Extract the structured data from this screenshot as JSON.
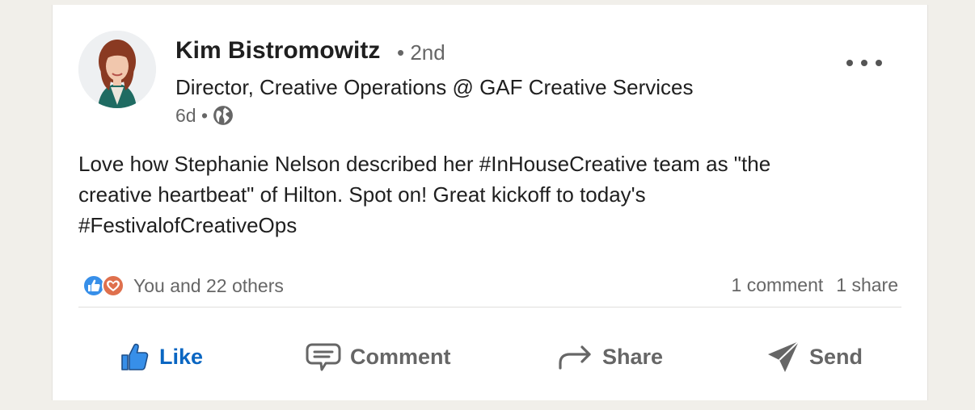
{
  "post": {
    "author": {
      "name": "Kim Bistromowitz",
      "degree": "• 2nd",
      "headline": "Director, Creative Operations @ GAF Creative Services",
      "age": "6d •",
      "visibility_icon": "globe-icon"
    },
    "text_line1": "Love how Stephanie Nelson described her #InHouseCreative team as \"the",
    "text_line2": "creative heartbeat\" of Hilton. Spot on! Great kickoff to today's",
    "text_line3": "#FestivalofCreativeOps",
    "reactions": {
      "icons": [
        "like-reaction-icon",
        "love-reaction-icon"
      ],
      "summary": "You and 22 others"
    },
    "counts": {
      "comments": "1 comment",
      "shares": "1 share"
    },
    "actions": {
      "like": "Like",
      "comment": "Comment",
      "share": "Share",
      "send": "Send"
    }
  },
  "colors": {
    "accent": "#0a66c2",
    "love": "#df704d",
    "muted_text": "#666666"
  }
}
